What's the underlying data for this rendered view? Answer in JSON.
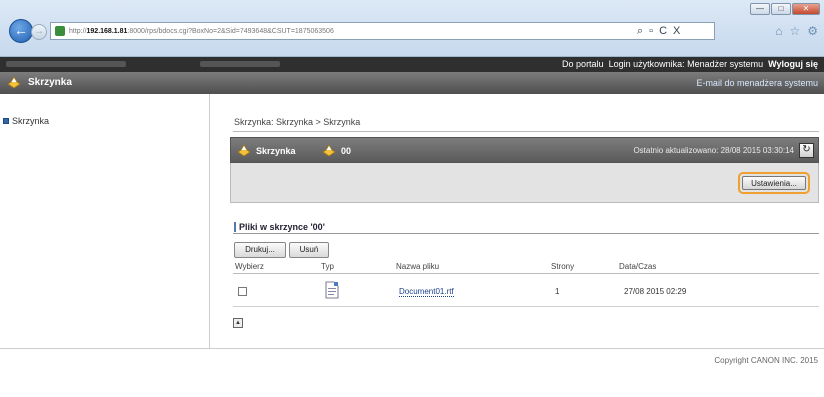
{
  "browser": {
    "url_prefix": "http://",
    "url_host": "192.168.1.81",
    "url_rest": ":8000/rps/bdocs.cgi?BoxNo=2&Sid=7493648&CSUT=1875063506",
    "search_icon": "search-icon",
    "refresh_glyph": "C",
    "stop_glyph": "X"
  },
  "topbar": {
    "portal": "Do portalu",
    "login_label": "Login użytkownika: Menadżer systemu",
    "logout": "Wyloguj się"
  },
  "titlebar": {
    "title": "Skrzynka",
    "mail": "E-mail do menadżera systemu"
  },
  "sidebar": {
    "items": [
      {
        "label": "Skrzynka"
      }
    ]
  },
  "main": {
    "breadcrumb": "Skrzynka: Skrzynka > Skrzynka",
    "box_name": "Skrzynka",
    "box_number": "00",
    "last_updated": "Ostatnio aktualizowano: 28/08 2015 03:30:14",
    "settings_button": "Ustawienia...",
    "files_title": "Pliki w skrzynce '00'",
    "print_button": "Drukuj...",
    "delete_button": "Usuń",
    "columns": [
      "Wybierz",
      "Typ",
      "Nazwa pliku",
      "Strony",
      "Data/Czas"
    ],
    "rows": [
      {
        "name": "Document01.rtf",
        "pages": "1",
        "datetime": "27/08 2015 02:29"
      }
    ]
  },
  "footer": {
    "copyright": "Copyright CANON INC. 2015"
  },
  "colors": {
    "highlight": "#f0a030",
    "link": "#1b3f8b",
    "header_dark": "#2f2f2f"
  }
}
